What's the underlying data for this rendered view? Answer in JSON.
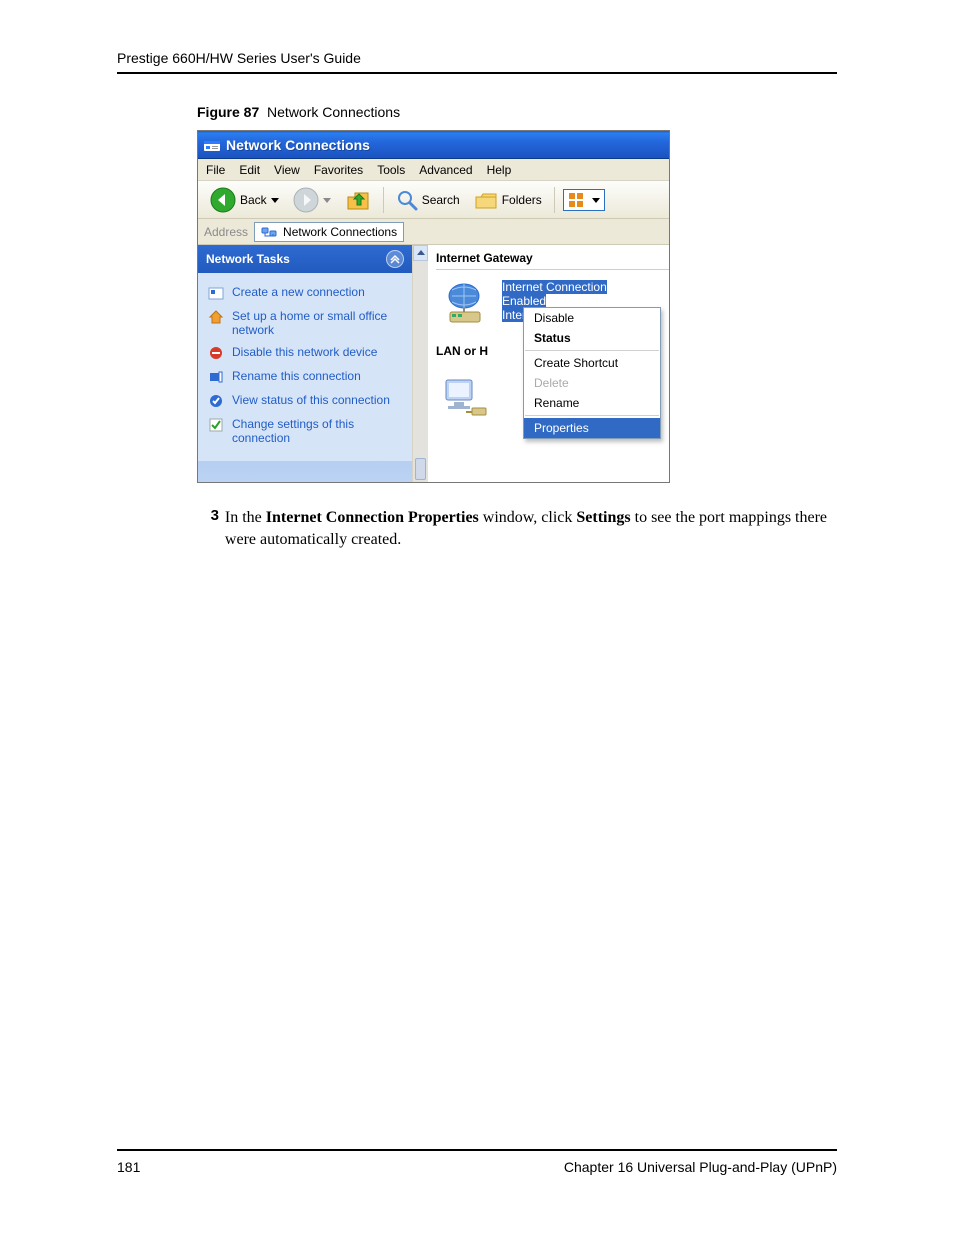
{
  "doc": {
    "running_head": "Prestige 660H/HW Series User's Guide",
    "figure_number": "Figure 87",
    "figure_title": "Network Connections",
    "step_number": "3",
    "step_text_1": "In the ",
    "step_bold_1": "Internet Connection Properties",
    "step_text_2": " window, click ",
    "step_bold_2": "Settings",
    "step_text_3": " to see the port mappings there were automatically created.",
    "page_number": "181",
    "chapter": "Chapter 16 Universal Plug-and-Play (UPnP)"
  },
  "win": {
    "title": "Network Connections",
    "menus": [
      "File",
      "Edit",
      "View",
      "Favorites",
      "Tools",
      "Advanced",
      "Help"
    ],
    "toolbar": {
      "back": "Back",
      "search": "Search",
      "folders": "Folders"
    },
    "address": {
      "label": "Address",
      "value": "Network Connections"
    },
    "tasks": {
      "heading": "Network Tasks",
      "items": [
        "Create a new connection",
        "Set up a home or small office network",
        "Disable this network device",
        "Rename this connection",
        "View status of this connection",
        "Change settings of this connection"
      ]
    },
    "right": {
      "group1": "Internet Gateway",
      "ig_line1": "Internet Connection",
      "ig_line2": "Enabled",
      "ig_line3": "Internet Connection",
      "group2": "LAN or H"
    },
    "context_menu": {
      "disable": "Disable",
      "status": "Status",
      "create_shortcut": "Create Shortcut",
      "delete": "Delete",
      "rename": "Rename",
      "properties": "Properties"
    }
  }
}
